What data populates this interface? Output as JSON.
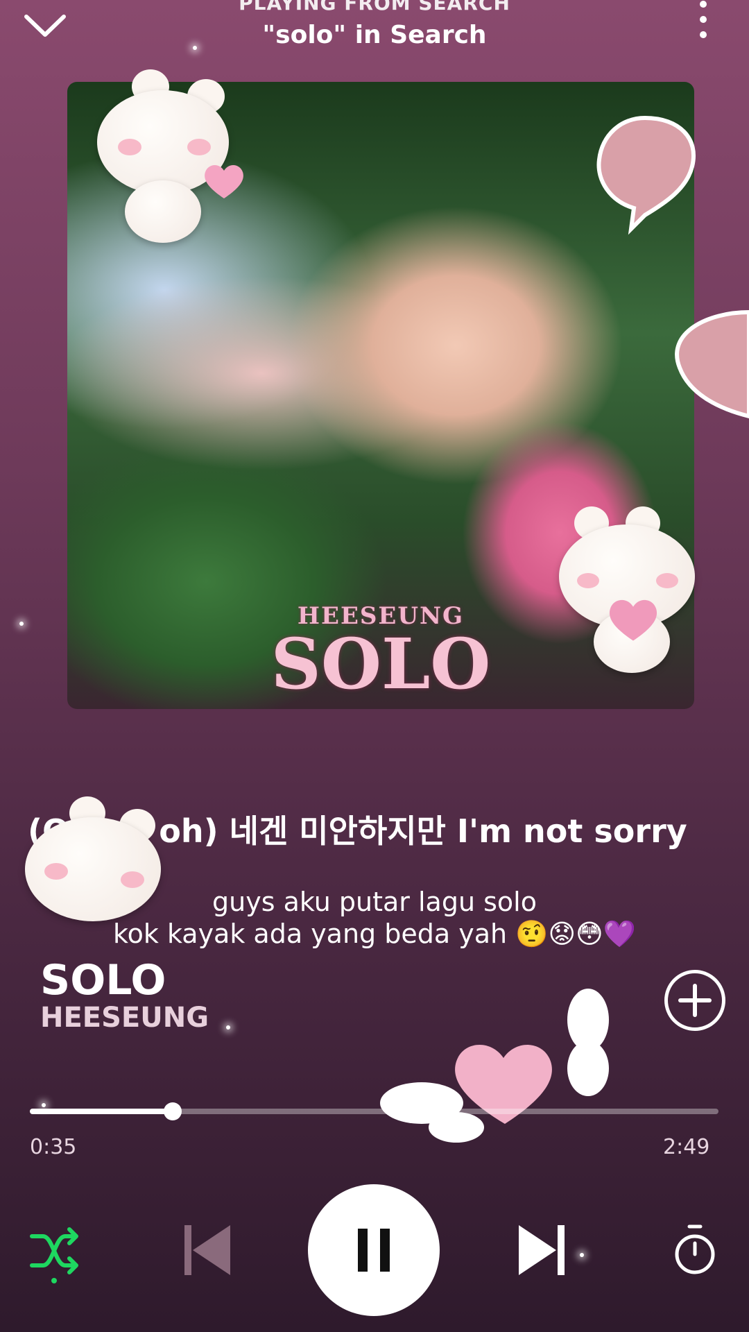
{
  "header": {
    "context_label": "PLAYING FROM SEARCH",
    "context_title": "\"solo\" in Search"
  },
  "album_art": {
    "artist_text": "HEESEUNG",
    "title_text": "SOLO"
  },
  "lyrics": {
    "current_line": "(Oh oh oh) 네겐 미안하지만 I'm not sorry"
  },
  "overlay_caption": {
    "line1": "guys aku putar lagu solo",
    "line2": "kok kayak ada yang beda yah 🤨😟😳💜"
  },
  "track": {
    "title": "SOLO",
    "artist": "HEESEUNG"
  },
  "playback": {
    "elapsed": "0:35",
    "duration": "2:49",
    "progress_fraction": 0.207,
    "state": "playing",
    "shuffle_active": true
  },
  "colors": {
    "accent_green": "#1ed760",
    "background_top": "#8a4a6e",
    "background_bottom": "#2e1a2c"
  },
  "icons": [
    "chevron-down-icon",
    "more-vertical-icon",
    "add-circle-icon",
    "shuffle-icon",
    "previous-icon",
    "pause-icon",
    "next-icon",
    "sleep-timer-icon"
  ]
}
